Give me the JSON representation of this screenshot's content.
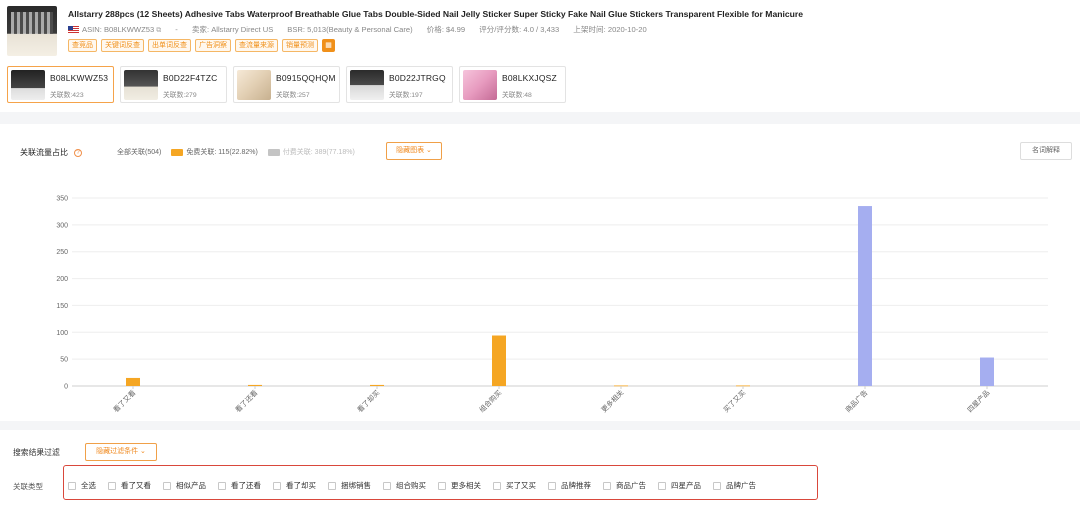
{
  "product": {
    "title": "Allstarry 288pcs (12 Sheets) Adhesive Tabs Waterproof Breathable Glue Tabs Double-Sided Nail Jelly Sticker Super Sticky Fake Nail Glue Stickers Transparent Flexible for Manicure",
    "asin": "ASIN: B08LKWWZ53",
    "dash": "-",
    "seller": "卖家: Allstarry Direct US",
    "bsr": "BSR: 5,013(Beauty & Personal Care)",
    "price": "价格: $4.99",
    "rating": "评分/评分数: 4.0 / 3,433",
    "launch": "上架时间: 2020-10-20",
    "tags": [
      "查竞品",
      "关键词反查",
      "出单词反查",
      "广告洞察",
      "查流量来源",
      "销量预测"
    ]
  },
  "asin_cards": [
    {
      "code": "B08LKWWZ53",
      "count": "关联数:423"
    },
    {
      "code": "B0D22F4TZC",
      "count": "关联数:279"
    },
    {
      "code": "B0915QQHQM",
      "count": "关联数:257"
    },
    {
      "code": "B0D22JTRGQ",
      "count": "关联数:197"
    },
    {
      "code": "B08LKXJQSZ",
      "count": "关联数:48"
    }
  ],
  "chart_section": {
    "title": "关联流量占比",
    "all": "全部关联(504)",
    "free": "免费关联: 115(22.82%)",
    "paid": "付费关联: 389(77.18%)",
    "hide_chart": "隐藏图表",
    "explain": "名词解释"
  },
  "colors": {
    "free": "#f5a623",
    "paid": "#a5aef0",
    "accent": "#f08a20",
    "highlight_box": "#d9483b"
  },
  "chart_data": {
    "type": "bar",
    "categories": [
      "看了又看",
      "看了还看",
      "看了却买",
      "组合购买",
      "更多相关",
      "买了又买",
      "商品广告",
      "四星产品"
    ],
    "values": [
      15,
      2,
      2,
      94,
      1,
      1,
      335,
      53
    ],
    "bar_colors": [
      "#f5a623",
      "#f5a623",
      "#f5a623",
      "#f5a623",
      "#f5a623",
      "#f5a623",
      "#a5aef0",
      "#a5aef0"
    ],
    "yticks": [
      0,
      50,
      100,
      150,
      200,
      250,
      300,
      350
    ],
    "ylim": [
      0,
      350
    ],
    "grid": true
  },
  "filter": {
    "title": "搜索结果过滤",
    "hide_filter": "隐藏过滤条件",
    "type_label": "关联类型",
    "options": [
      "全选",
      "看了又看",
      "相似产品",
      "看了还看",
      "看了却买",
      "捆绑销售",
      "组合购买",
      "更多相关",
      "买了又买",
      "品牌推荐",
      "商品广告",
      "四星产品",
      "品牌广告"
    ]
  }
}
